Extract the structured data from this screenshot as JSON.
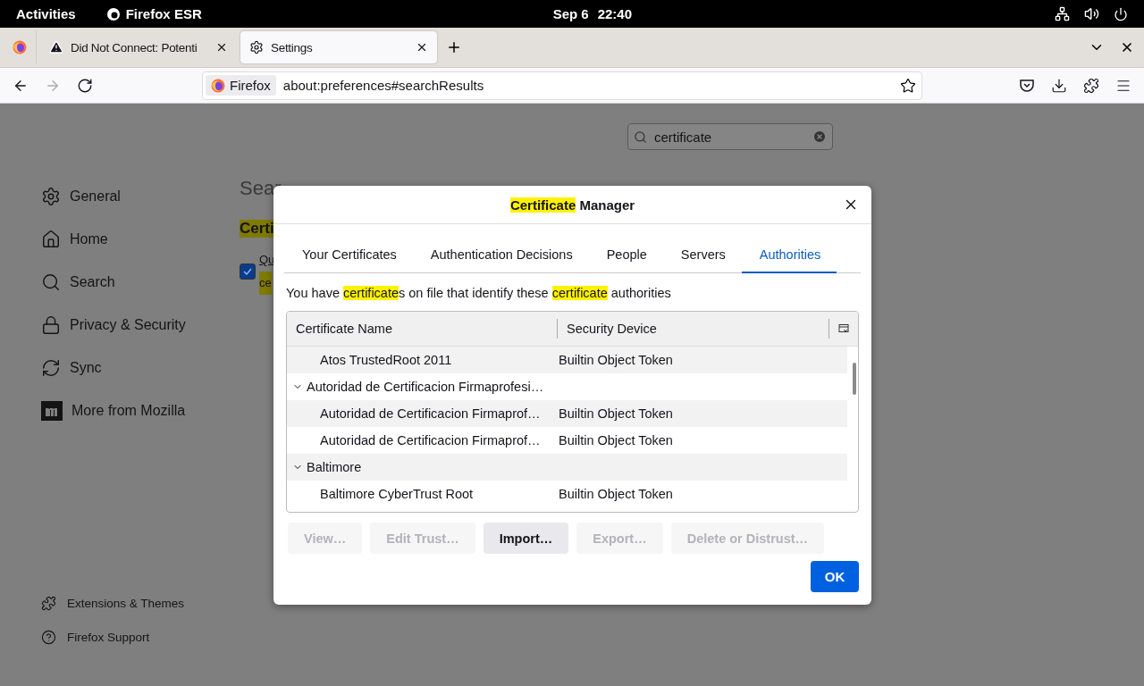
{
  "top_bar": {
    "activities": "Activities",
    "app": "Firefox ESR",
    "date": "Sep 6",
    "time": "22:40"
  },
  "tabs": [
    {
      "label": "Did Not Connect: Potenti",
      "selected": false
    },
    {
      "label": "Settings",
      "selected": true
    }
  ],
  "nav_buttons": [
    {
      "kind": "back",
      "disabled": false
    },
    {
      "kind": "forward",
      "disabled": true
    },
    {
      "kind": "reload",
      "disabled": false
    }
  ],
  "address_bar": {
    "identity": "Firefox",
    "url": "about:preferences#searchResults"
  },
  "search": {
    "value": "certificate"
  },
  "sidebar": {
    "items": [
      "General",
      "Home",
      "Search",
      "Privacy & Security",
      "Sync",
      "More from Mozilla"
    ],
    "footer": [
      "Extensions & Themes",
      "Firefox Support"
    ]
  },
  "results": {
    "heading": "Sear",
    "group_title": "Certi",
    "checkbox": {
      "label": "Qu",
      "checked": true
    },
    "note": "ce"
  },
  "dialog": {
    "title": [
      {
        "text": "Certificate",
        "highlight": true
      },
      {
        "text": " Manager",
        "highlight": false
      }
    ],
    "tabs": [
      {
        "label": "Your Certificates",
        "selected": false
      },
      {
        "label": "Authentication Decisions",
        "selected": false
      },
      {
        "label": "People",
        "selected": false
      },
      {
        "label": "Servers",
        "selected": false
      },
      {
        "label": "Authorities",
        "selected": true
      }
    ],
    "description": [
      {
        "text": "You have ",
        "highlight": false
      },
      {
        "text": "certificate",
        "highlight": true
      },
      {
        "text": "s on file that identify these ",
        "highlight": false
      },
      {
        "text": "certificate",
        "highlight": true
      },
      {
        "text": " authorities",
        "highlight": false
      }
    ],
    "columns": [
      "Certificate Name",
      "Security Device"
    ],
    "rows": [
      {
        "kind": "cert",
        "name": "Atos TrustedRoot 2011",
        "device": "Builtin Object Token"
      },
      {
        "kind": "group",
        "name": "Autoridad de Certificacion Firmaprofesi…",
        "expanded": true
      },
      {
        "kind": "cert",
        "name": "Autoridad de Certificacion Firmaprof…",
        "device": "Builtin Object Token"
      },
      {
        "kind": "cert",
        "name": "Autoridad de Certificacion Firmaprof…",
        "device": "Builtin Object Token"
      },
      {
        "kind": "group",
        "name": "Baltimore",
        "expanded": true
      },
      {
        "kind": "cert",
        "name": "Baltimore CyberTrust Root",
        "device": "Builtin Object Token"
      }
    ],
    "buttons": [
      {
        "label": "View…",
        "disabled": true
      },
      {
        "label": "Edit Trust…",
        "disabled": true
      },
      {
        "label": "Import…",
        "disabled": false
      },
      {
        "label": "Export…",
        "disabled": true
      },
      {
        "label": "Delete or Distrust…",
        "disabled": true
      }
    ],
    "ok": "OK"
  }
}
